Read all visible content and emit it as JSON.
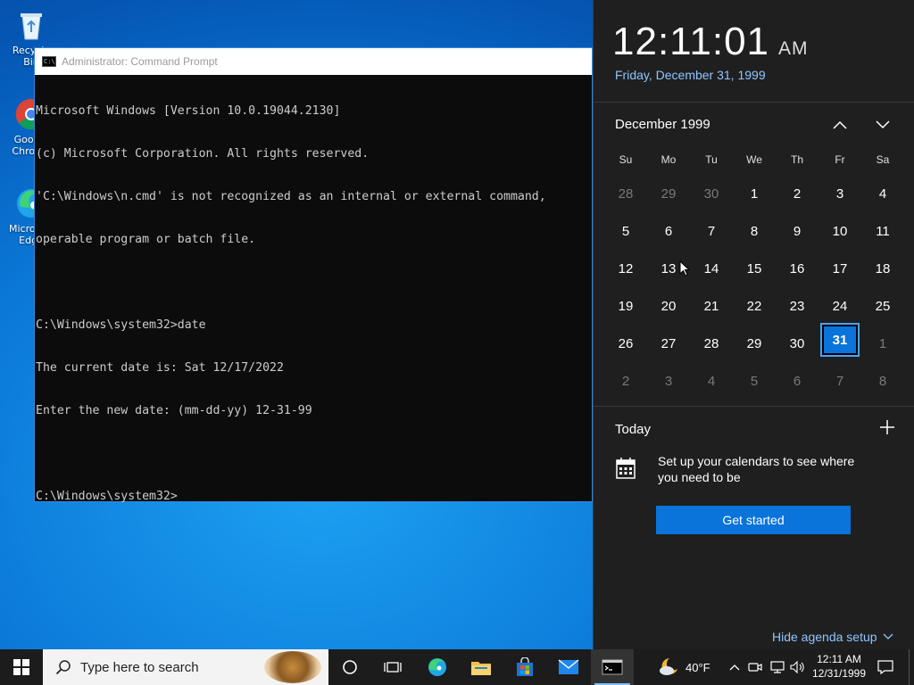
{
  "desktop": {
    "icons": [
      {
        "label": "Recycle Bin"
      },
      {
        "label": "Google Chrome"
      },
      {
        "label": "Microsoft Edge"
      }
    ]
  },
  "cmd": {
    "title": "Administrator: Command Prompt",
    "lines": [
      "Microsoft Windows [Version 10.0.19044.2130]",
      "(c) Microsoft Corporation. All rights reserved.",
      "'C:\\Windows\\n.cmd' is not recognized as an internal or external command,",
      "operable program or batch file.",
      "",
      "C:\\Windows\\system32>date",
      "The current date is: Sat 12/17/2022",
      "Enter the new date: (mm-dd-yy) 12-31-99",
      "",
      "C:\\Windows\\system32>"
    ]
  },
  "flyout": {
    "time": "12:11:01",
    "ampm": "AM",
    "long_date": "Friday, December 31, 1999",
    "month_label": "December 1999",
    "weekdays": [
      "Su",
      "Mo",
      "Tu",
      "We",
      "Th",
      "Fr",
      "Sa"
    ],
    "weeks": [
      [
        "28",
        "29",
        "30",
        "1",
        "2",
        "3",
        "4"
      ],
      [
        "5",
        "6",
        "7",
        "8",
        "9",
        "10",
        "11"
      ],
      [
        "12",
        "13",
        "14",
        "15",
        "16",
        "17",
        "18"
      ],
      [
        "19",
        "20",
        "21",
        "22",
        "23",
        "24",
        "25"
      ],
      [
        "26",
        "27",
        "28",
        "29",
        "30",
        "31",
        "1"
      ],
      [
        "2",
        "3",
        "4",
        "5",
        "6",
        "7",
        "8"
      ]
    ],
    "today_label": "Today",
    "agenda_text": "Set up your calendars to see where you need to be",
    "get_started": "Get started",
    "hide_agenda": "Hide agenda setup",
    "selected_color": "#0a74da"
  },
  "taskbar": {
    "search_placeholder": "Type here to search",
    "weather_temp": "40°F",
    "clock_time": "12:11 AM",
    "clock_date": "12/31/1999",
    "apps": [
      "task-view-icon",
      "edge-icon",
      "file-explorer-icon",
      "store-icon",
      "mail-icon",
      "command-prompt-icon"
    ]
  }
}
